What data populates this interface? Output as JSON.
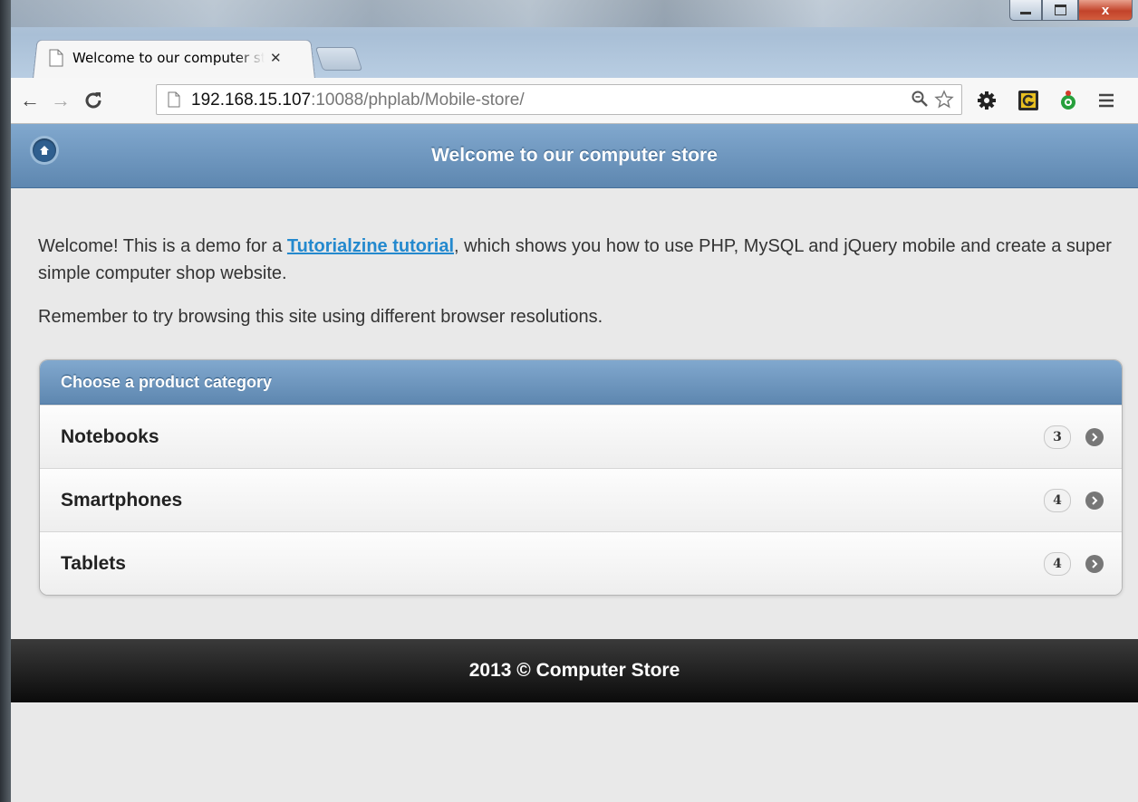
{
  "browser": {
    "tab_title": "Welcome to our computer store",
    "tab_close_icon": "close-icon",
    "url_host": "192.168.15.107",
    "url_rest": ":10088/phplab/Mobile-store/",
    "window_controls": {
      "minimize": "minimize-icon",
      "maximize": "maximize-icon",
      "close": "x"
    }
  },
  "header": {
    "title": "Welcome to our computer store",
    "home_icon": "home-icon"
  },
  "content": {
    "intro_before_link": "Welcome! This is a demo for a ",
    "intro_link": "Tutorialzine tutorial",
    "intro_after_link": ", which shows you how to use PHP, MySQL and jQuery mobile and create a super simple computer shop website.",
    "intro2": "Remember to try browsing this site using different browser resolutions."
  },
  "categories": {
    "header": "Choose a product category",
    "items": [
      {
        "label": "Notebooks",
        "count": "3"
      },
      {
        "label": "Smartphones",
        "count": "4"
      },
      {
        "label": "Tablets",
        "count": "4"
      }
    ]
  },
  "footer": {
    "text": "2013 © Computer Store"
  },
  "colors": {
    "header_blue": "#6f98c0",
    "footer_black": "#1a1a1a",
    "link_blue": "#2489ce",
    "page_bg": "#e9e9e9"
  }
}
